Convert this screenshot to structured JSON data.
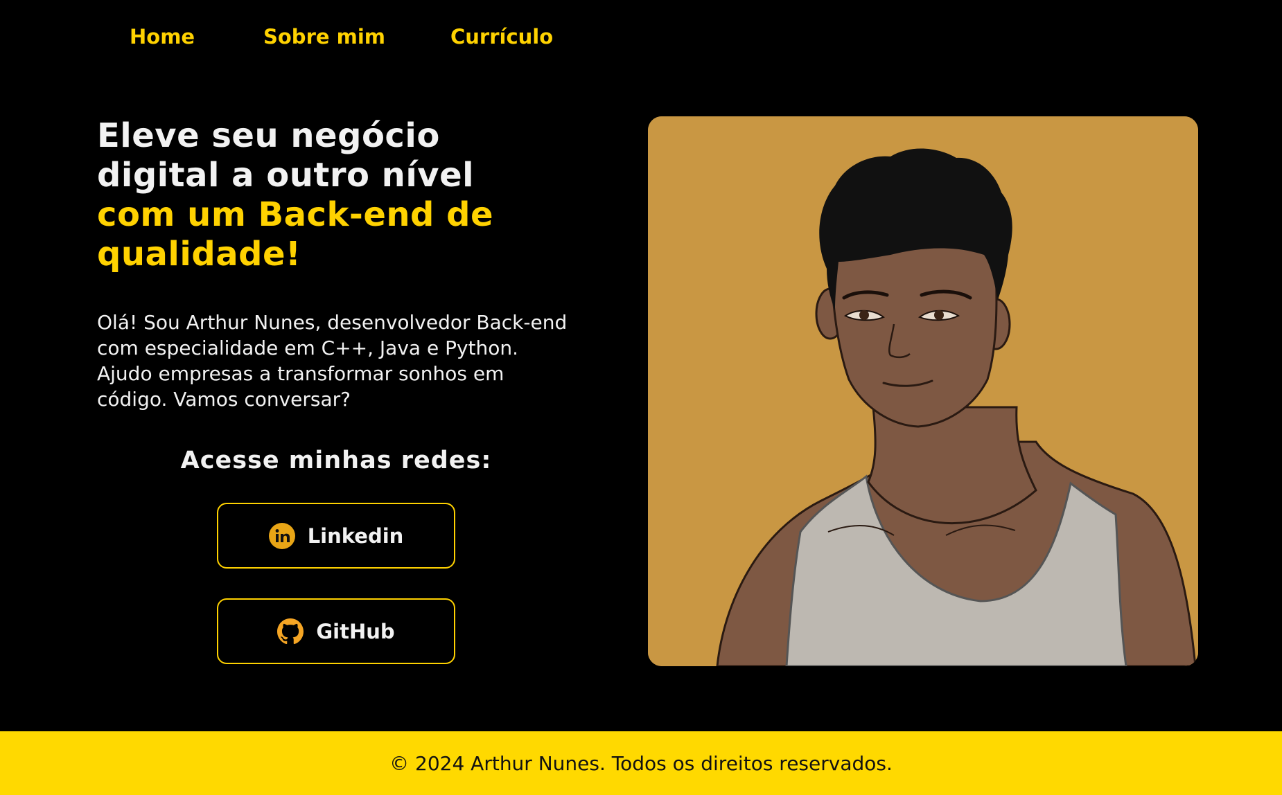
{
  "nav": {
    "items": [
      "Home",
      "Sobre mim",
      "Currículo"
    ]
  },
  "hero": {
    "headline_white_1": "Eleve seu negócio",
    "headline_white_2": "digital a outro nível",
    "headline_yellow_1": "com um Back-end de",
    "headline_yellow_2": "qualidade!",
    "intro": "Olá! Sou Arthur Nunes, desenvolvedor Back-end com especialidade em C++, Java e Python. Ajudo empresas a transformar sonhos em código. Vamos conversar?"
  },
  "social": {
    "title": "Acesse minhas redes:",
    "buttons": [
      {
        "label": "Linkedin",
        "icon": "linkedin-icon"
      },
      {
        "label": "GitHub",
        "icon": "github-icon"
      }
    ]
  },
  "portrait": {
    "icon": "portrait-illustration"
  },
  "footer": {
    "text": "© 2024 Arthur Nunes. Todos os direitos reservados."
  },
  "colors": {
    "accent": "#FFD200",
    "background": "#000000",
    "portrait_bg": "#C99743",
    "footer_bg": "#FFD900"
  }
}
